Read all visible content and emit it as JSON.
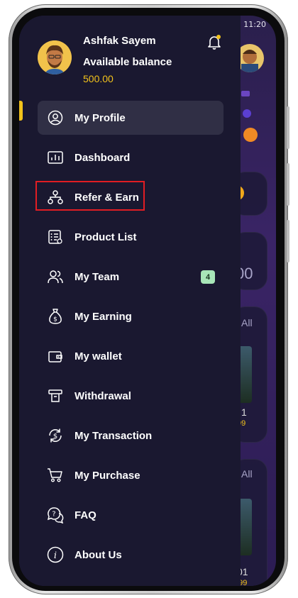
{
  "status_bar": {
    "time": "11:20"
  },
  "drawer": {
    "user_name": "Ashfak Sayem",
    "balance_label": "Available balance",
    "balance_value": "500.00",
    "menu": [
      {
        "label": "My Profile",
        "icon": "user-circle-icon",
        "active": true
      },
      {
        "label": "Dashboard",
        "icon": "bar-chart-icon"
      },
      {
        "label": "Refer & Earn",
        "icon": "hierarchy-icon",
        "highlighted": true
      },
      {
        "label": "Product List",
        "icon": "list-icon"
      },
      {
        "label": "My Team",
        "icon": "users-icon",
        "badge": "4"
      },
      {
        "label": "My Earning",
        "icon": "money-bag-icon"
      },
      {
        "label": "My wallet",
        "icon": "wallet-icon"
      },
      {
        "label": "Withdrawal",
        "icon": "withdrawal-icon"
      },
      {
        "label": "My Transaction",
        "icon": "dollar-refresh-icon"
      },
      {
        "label": "My Purchase",
        "icon": "cart-icon"
      },
      {
        "label": "FAQ",
        "icon": "chat-question-icon"
      },
      {
        "label": "About Us",
        "icon": "info-icon"
      }
    ]
  },
  "background": {
    "balance_fragment": "00",
    "see_all_1": "All",
    "see_all_2": "All",
    "price_fragment_1": "99",
    "price_fragment_2": "999",
    "number_fragment_1": "1",
    "number_fragment_2": "01"
  },
  "colors": {
    "accent": "#f2c21b",
    "drawer_bg": "#1a1830",
    "highlight": "#e11d23",
    "badge_bg": "#a8e6b8"
  }
}
